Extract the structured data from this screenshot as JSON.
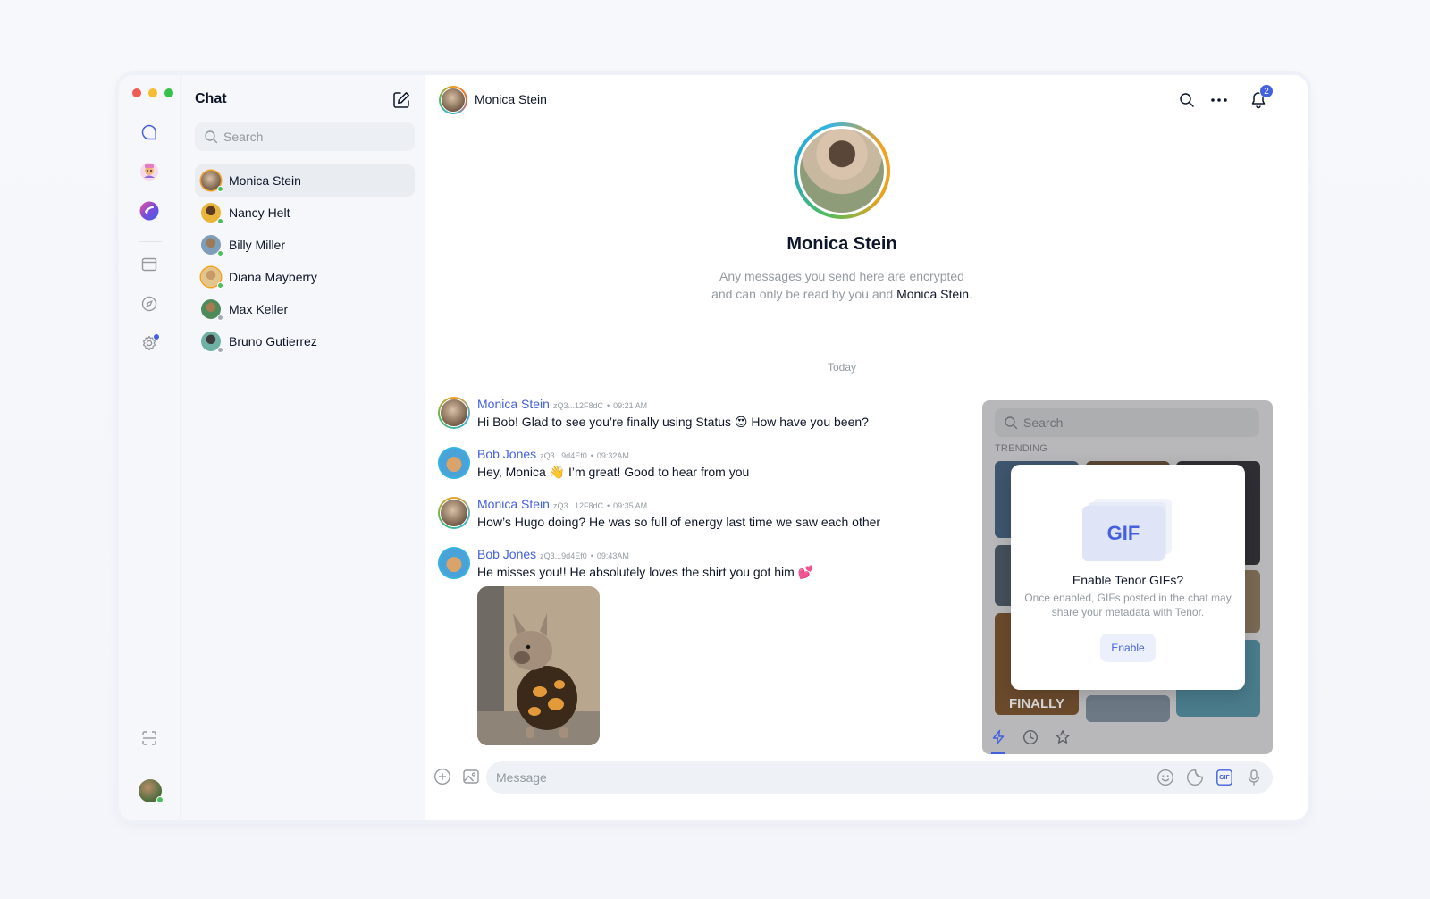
{
  "window": {
    "traffic_lights": [
      "#ef5a52",
      "#f5bd2f",
      "#36c14a"
    ]
  },
  "rail": {
    "items": [
      {
        "name": "chat",
        "icon": "chat-bubble-icon"
      },
      {
        "name": "community",
        "icon": "community-avatar-icon"
      },
      {
        "name": "wallet",
        "icon": "wallet-logo-icon"
      },
      {
        "name": "browser",
        "icon": "browser-window-icon"
      },
      {
        "name": "discover",
        "icon": "compass-icon"
      },
      {
        "name": "settings",
        "icon": "gear-icon"
      }
    ],
    "bottom": {
      "scan_icon": "scan-icon",
      "avatar": "user-avatar"
    }
  },
  "sidebar": {
    "title": "Chat",
    "search_placeholder": "Search",
    "contacts": [
      {
        "name": "Monica Stein",
        "active": true,
        "online": true
      },
      {
        "name": "Nancy Helt",
        "active": false,
        "online": true
      },
      {
        "name": "Billy Miller",
        "active": false,
        "online": true
      },
      {
        "name": "Diana Mayberry",
        "active": false,
        "online": true
      },
      {
        "name": "Max Keller",
        "active": false,
        "online": false
      },
      {
        "name": "Bruno Gutierrez",
        "active": false,
        "online": false
      }
    ]
  },
  "topbar": {
    "contact_name": "Monica Stein",
    "notification_count": "2"
  },
  "profile": {
    "name": "Monica Stein",
    "description_prefix": "Any messages you send here are encrypted and can only be read by you and",
    "description_name": "Monica Stein",
    "description_suffix": "."
  },
  "day_separator": "Today",
  "messages": [
    {
      "author": "Monica Stein",
      "key": "zQ3...12F8dC",
      "time": "09:21 AM",
      "text": "Hi Bob! Glad to see you’re finally using Status 😍 How have you been?"
    },
    {
      "author": "Bob Jones",
      "key": "zQ3...9d4Ef0",
      "time": "09:32AM",
      "text": "Hey, Monica 👋 I’m great! Good to hear from you"
    },
    {
      "author": "Monica Stein",
      "key": "zQ3...12F8dC",
      "time": "09:35 AM",
      "text": "How’s Hugo doing? He was so full of energy last time we saw each other"
    },
    {
      "author": "Bob Jones",
      "key": "zQ3...9d4Ef0",
      "time": "09:43AM",
      "text": "He misses you!! He absolutely loves the shirt you got him 💕"
    }
  ],
  "gif_panel": {
    "search_placeholder": "Search",
    "trending_label": "TRENDING",
    "tile_text": "FINALLY",
    "modal": {
      "badge": "GIF",
      "title": "Enable Tenor GIFs?",
      "description": "Once enabled, GIFs posted in the chat may share your metadata with Tenor.",
      "button": "Enable"
    }
  },
  "composer": {
    "placeholder": "Message",
    "gif_button": "GIF"
  }
}
